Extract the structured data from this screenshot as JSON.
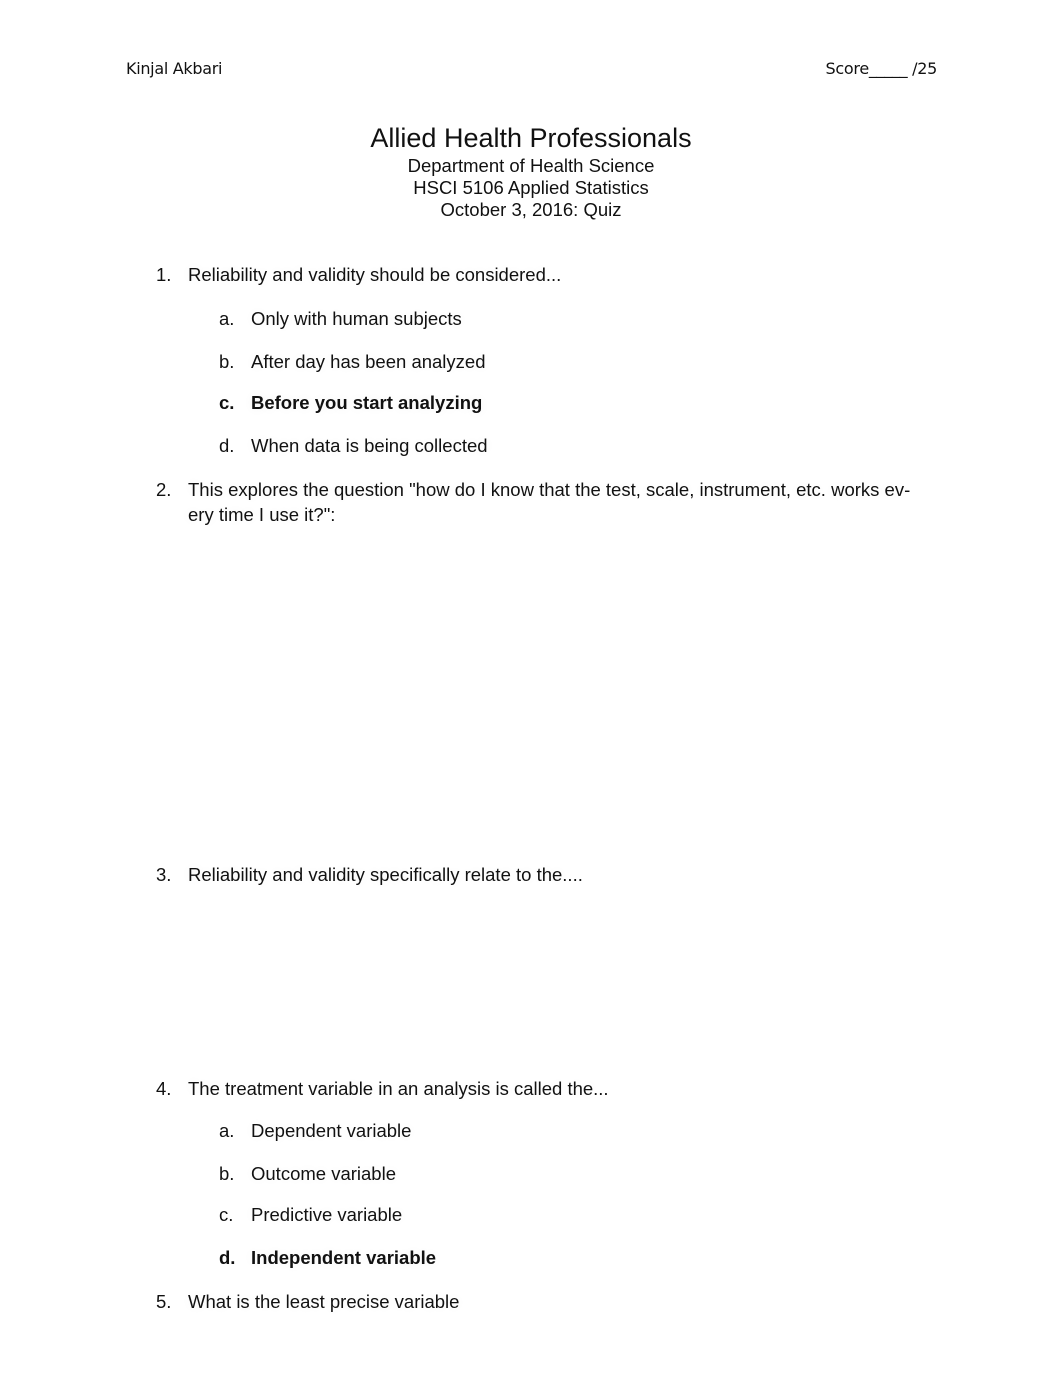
{
  "header": {
    "student_name": "Kinjal Akbari",
    "score_label": "Score_____ /25"
  },
  "title_block": {
    "title": "Allied Health Professionals",
    "department": "Department of Health Science",
    "course": "HSCI 5106 Applied Statistics",
    "date_line": "October 3, 2016: Quiz"
  },
  "questions": [
    {
      "number": "1.",
      "text": "Reliability and validity should be considered...",
      "options": [
        {
          "letter": "a.",
          "text": "Only with human subjects",
          "selected": false
        },
        {
          "letter": "b.",
          "text": "After day has been analyzed",
          "selected": false
        },
        {
          "letter": "c.",
          "text": "Before you start analyzing",
          "selected": true
        },
        {
          "letter": "d.",
          "text": "When data is being collected",
          "selected": false
        }
      ]
    },
    {
      "number": "2.",
      "text": "This explores the question \"how do I know that the test, scale, instrument, etc. works ev-ery time I use it?\":",
      "line1": "This explores the question \"how do I know that the test, scale, instrument, etc. works ev-",
      "line2": "ery time I use it?\":",
      "options": []
    },
    {
      "number": "3.",
      "text": "Reliability and validity specifically relate to the....",
      "options": []
    },
    {
      "number": "4.",
      "text": "The treatment variable in an analysis is called the...",
      "options": [
        {
          "letter": "a.",
          "text": "Dependent variable",
          "selected": false
        },
        {
          "letter": "b.",
          "text": "Outcome variable",
          "selected": false
        },
        {
          "letter": "c.",
          "text": "Predictive variable",
          "selected": false
        },
        {
          "letter": "d.",
          "text": "Independent variable",
          "selected": true
        }
      ]
    },
    {
      "number": "5.",
      "text": "What is the least precise variable",
      "options": []
    }
  ]
}
